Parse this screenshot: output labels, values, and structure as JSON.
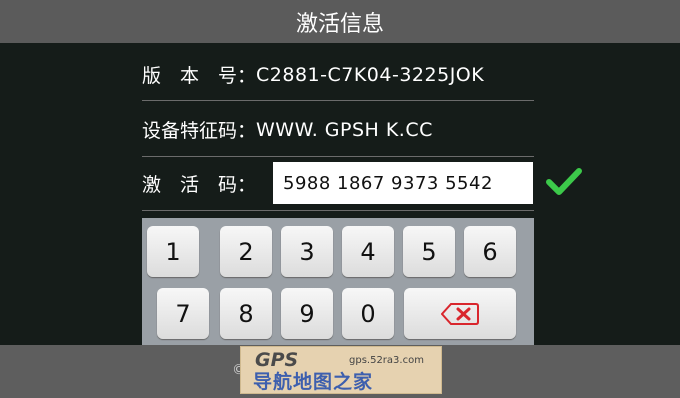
{
  "title": "激活信息",
  "info": {
    "version_label": "版　本　号：",
    "version_value": "C2881-C7K04-3225JOK",
    "feature_label": "设备特征码：",
    "feature_value": "WWW. GPSH K.CC",
    "activation_label": "激　活　码：",
    "activation_value": "5988 1867 9373 5542"
  },
  "keypad": {
    "row1": [
      "1",
      "2",
      "3",
      "4",
      "5",
      "6"
    ],
    "row2": [
      "7",
      "8",
      "9",
      "0"
    ]
  },
  "icons": {
    "check": "check-icon",
    "backspace": "backspace-icon"
  },
  "colors": {
    "check": "#3cc94a",
    "backspace_x": "#d9262d"
  },
  "watermark": {
    "brand": "GPS",
    "url": "gps.52ra3.com",
    "name": "导航地图之家"
  },
  "bottom_snippet": "©"
}
